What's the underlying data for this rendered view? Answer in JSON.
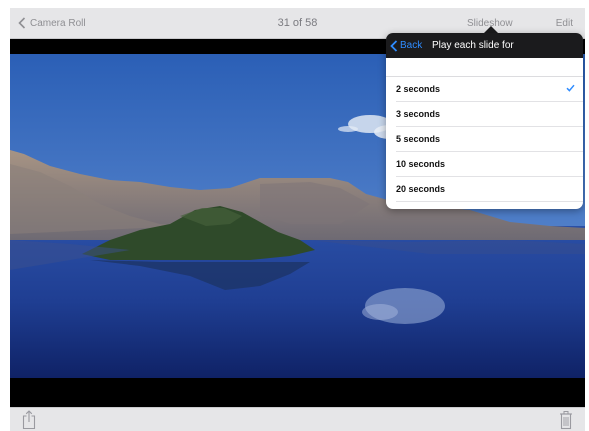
{
  "nav": {
    "back_label": "Camera Roll",
    "title": "31 of 58",
    "slideshow_label": "Slideshow",
    "edit_label": "Edit"
  },
  "popover": {
    "back_label": "Back",
    "title": "Play each slide for",
    "options": [
      {
        "label": "2 seconds",
        "selected": true
      },
      {
        "label": "3 seconds",
        "selected": false
      },
      {
        "label": "5 seconds",
        "selected": false
      },
      {
        "label": "10 seconds",
        "selected": false
      },
      {
        "label": "20 seconds",
        "selected": false
      }
    ]
  },
  "toolbar": {
    "share_icon": "share-icon",
    "trash_icon": "trash-icon"
  },
  "colors": {
    "accent": "#2f8cff",
    "bar_background": "#e6e6e8",
    "popover_header": "#1b1b1d"
  }
}
